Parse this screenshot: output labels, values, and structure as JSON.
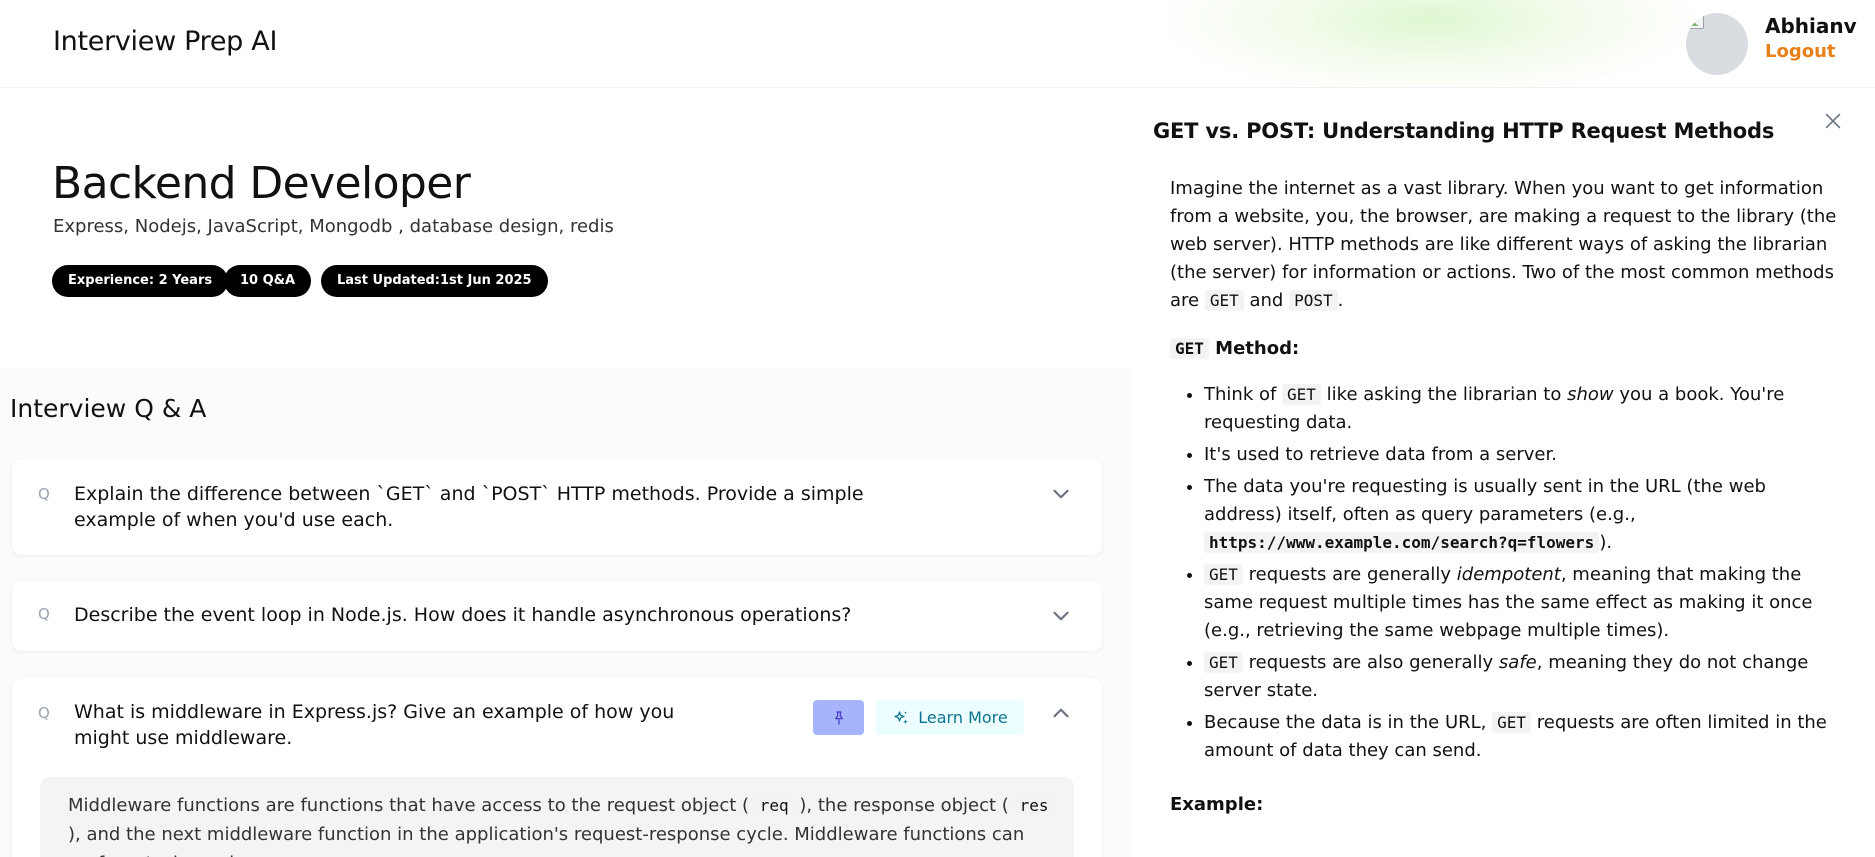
{
  "header": {
    "app_title": "Interview Prep AI",
    "user_name": "Abhianv",
    "logout_label": "Logout"
  },
  "session": {
    "role": "Backend Developer",
    "topics": "Express, Nodejs, JavaScript, Mongodb , database design, redis",
    "experience": "Experience: 2 Years",
    "qa_count": "10 Q&A",
    "last_updated": "Last Updated:1st Jun 2025"
  },
  "qa": {
    "heading": "Interview Q & A",
    "q_marker": "Q",
    "items": [
      {
        "question": "Explain the difference between `GET` and `POST` HTTP methods. Provide a simple example of when you'd use each.",
        "expanded": false
      },
      {
        "question": "Describe the event loop in Node.js. How does it handle asynchronous operations?",
        "expanded": false
      },
      {
        "question": "What is middleware in Express.js? Give an example of how you might use middleware.",
        "expanded": true,
        "learn_more_label": "Learn More",
        "answer": {
          "t1": "Middleware functions are functions that have access to the request object ( ",
          "c1": "req",
          "t2": " ), the response object ( ",
          "c2": "res",
          "t3": " ), and the next middleware function in the application's request-response cycle. Middleware functions can perform tasks such as"
        }
      }
    ]
  },
  "panel": {
    "title": "GET vs. POST: Understanding HTTP Request Methods",
    "intro": {
      "t1": "Imagine the internet as a vast library. When you want to get information from a website, you, the browser, are making a request to the library (the web server). HTTP methods are like different ways of asking the librarian (the server) for information or actions. Two of the most common methods are ",
      "c1": "GET",
      "t2": " and ",
      "c2": "POST",
      "t3": "."
    },
    "get_heading": {
      "code": "GET",
      "text": " Method:"
    },
    "bullets": {
      "b1": {
        "t1": "Think of ",
        "c1": "GET",
        "t2": " like asking the librarian to ",
        "em": "show",
        "t3": " you a book. You're requesting data."
      },
      "b2": {
        "t1": "It's used to retrieve data from a server."
      },
      "b3": {
        "t1": "The data you're requesting is usually sent in the URL (the web address) itself, often as query parameters (e.g., ",
        "c1": "https://www.example.com/search?q=flowers",
        "t2": ")."
      },
      "b4": {
        "c1": "GET",
        "t1": " requests are generally ",
        "em": "idempotent",
        "t2": ", meaning that making the same request multiple times has the same effect as making it once (e.g., retrieving the same webpage multiple times)."
      },
      "b5": {
        "c1": "GET",
        "t1": " requests are also generally ",
        "em": "safe",
        "t2": ", meaning they do not change server state."
      },
      "b6": {
        "t1": "Because the data is in the URL, ",
        "c1": "GET",
        "t2": " requests are often limited in the amount of data they can send."
      }
    },
    "example_heading": "Example:"
  },
  "icons": {
    "chevron_down": "chevron-down-icon",
    "chevron_up": "chevron-up-icon",
    "pin": "pin-icon",
    "sparkle": "sparkle-icon",
    "close": "close-icon"
  },
  "colors": {
    "logout": "#e8801a",
    "pin_bg": "#a5b4fc",
    "learn_bg": "#ecfeff",
    "learn_text": "#0e7490"
  }
}
